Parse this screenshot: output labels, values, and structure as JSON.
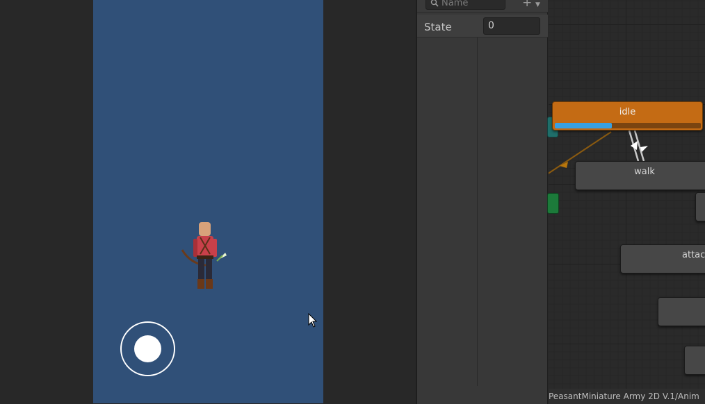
{
  "parameters": {
    "search_placeholder": "Name",
    "add_symbol": "+",
    "dropdown_symbol": "▼",
    "items": [
      {
        "name": "State",
        "value": "0"
      }
    ]
  },
  "graph": {
    "states": [
      {
        "name": "idle",
        "active": true,
        "progress": 0.39
      },
      {
        "name": "walk"
      },
      {
        "name": "attac"
      }
    ],
    "status_path": "PeasantMiniature Army 2D V.1/Anim"
  },
  "colors": {
    "game_background": "#305078",
    "active_state": "#c46b14",
    "progress": "#3aa0e0",
    "entry_state": "#1f6e6a",
    "any_state": "#1c7a3a",
    "transition_line": "#8a5a10"
  },
  "icons": {
    "search": "search-icon",
    "cursor": "mouse-cursor-icon"
  }
}
